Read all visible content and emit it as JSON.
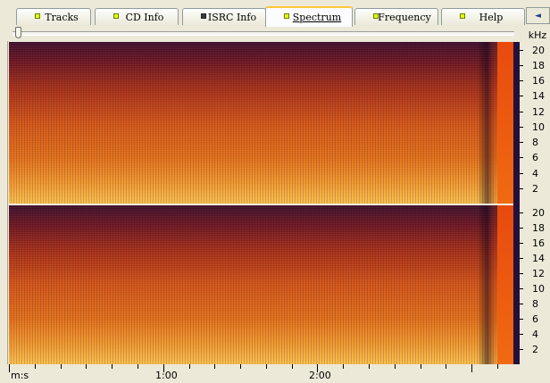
{
  "tabs": [
    {
      "label": "Tracks",
      "icon": "green-square-icon",
      "active": false
    },
    {
      "label": "CD Info",
      "icon": "green-square-icon",
      "active": false
    },
    {
      "label": "ISRC Info",
      "icon": "dark-square-icon",
      "active": false
    },
    {
      "label": "Spectrum",
      "icon": "green-square-icon",
      "active": true
    },
    {
      "label": "Frequency",
      "icon": "green-square-icon",
      "active": false
    },
    {
      "label": "Help",
      "icon": "green-square-icon",
      "active": false
    }
  ],
  "nav_arrows": "◄",
  "freq_unit_label": "kHz",
  "time_axis_label": "m:s",
  "y_ticks_khz": [
    "20",
    "18",
    "16",
    "14",
    "12",
    "10",
    "8",
    "6",
    "4",
    "2"
  ],
  "x_major_labels": [
    "1:00",
    "2:00"
  ],
  "colors": {
    "background": "#ece9d8",
    "spectrum_low": "#f8c050",
    "spectrum_mid": "#e0621a",
    "spectrum_high": "#6a1424",
    "spectrum_top": "#3a0e30",
    "active_tab_accent": "#ffc83c"
  },
  "chart_data": {
    "type": "heatmap",
    "title": "",
    "xlabel": "m:s",
    "ylabel": "kHz",
    "channels": 2,
    "ylim": [
      0,
      21
    ],
    "yticks": [
      2,
      4,
      6,
      8,
      10,
      12,
      14,
      16,
      18,
      20
    ],
    "xticks": [
      "1:00",
      "2:00"
    ],
    "duration_seconds": 190
  }
}
